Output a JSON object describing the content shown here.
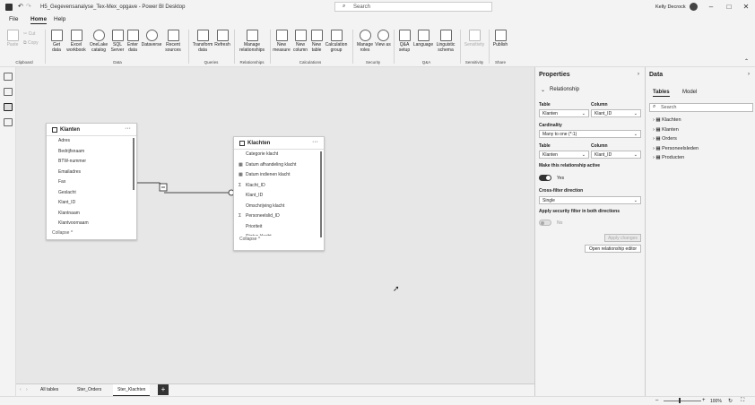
{
  "window": {
    "title": "H5_Gegevensanalyse_Tex-Mex_opgave - Power BI Desktop",
    "search_placeholder": "Search",
    "user": "Kelly Decrock"
  },
  "menu": {
    "file": "File",
    "home": "Home",
    "help": "Help"
  },
  "ribbon": {
    "clipboard": {
      "paste": "Paste",
      "cut": "Cut",
      "copy": "Copy",
      "group": "Clipboard"
    },
    "data": {
      "get_data": "Get data",
      "excel": "Excel workbook",
      "onelake": "OneLake catalog",
      "sql": "SQL Server",
      "enter": "Enter data",
      "dataverse": "Dataverse",
      "recent": "Recent sources",
      "group": "Data"
    },
    "queries": {
      "transform": "Transform data",
      "refresh": "Refresh",
      "group": "Queries"
    },
    "relationships": {
      "manage": "Manage relationships",
      "group": "Relationships"
    },
    "calculations": {
      "new_measure": "New measure",
      "new_column": "New column",
      "new_table": "New table",
      "calc_group": "Calculation group",
      "group": "Calculations"
    },
    "security": {
      "manage_roles": "Manage roles",
      "view_as": "View as",
      "group": "Security"
    },
    "qa": {
      "qa_setup": "Q&A setup",
      "language": "Language",
      "schema": "Linguistic schema",
      "group": "Q&A"
    },
    "sensitivity": {
      "label": "Sensitivity",
      "group": "Sensitivity"
    },
    "share": {
      "publish": "Publish",
      "group": "Share"
    }
  },
  "model": {
    "table1": {
      "name": "Klanten",
      "fields": [
        "Adres",
        "Bedrijfsnaam",
        "BTW-nummer",
        "Emailadres",
        "Fax",
        "Geslacht",
        "Klant_ID",
        "Klantnaam",
        "Klantvoornaam"
      ],
      "collapse": "Collapse ^"
    },
    "table2": {
      "name": "Klachten",
      "fields": [
        {
          "icon": "",
          "name": "Categorie klacht"
        },
        {
          "icon": "▦",
          "name": "Datum afhandeling klacht"
        },
        {
          "icon": "▦",
          "name": "Datum indienen klacht"
        },
        {
          "icon": "Σ",
          "name": "Klacht_ID"
        },
        {
          "icon": "",
          "name": "Klant_ID"
        },
        {
          "icon": "",
          "name": "Omschrijving klacht"
        },
        {
          "icon": "Σ",
          "name": "Personeelslid_ID"
        },
        {
          "icon": "",
          "name": "Prioriteit"
        },
        {
          "icon": "",
          "name": "Status klacht"
        }
      ],
      "collapse": "Collapse ^"
    }
  },
  "page_tabs": {
    "all": "All tables",
    "t1": "Ster_Orders",
    "t2": "Ster_Klachten",
    "add": "+"
  },
  "status": {
    "zoom": "100%"
  },
  "properties": {
    "title": "Properties",
    "section": "Relationship",
    "table_label": "Table",
    "column_label": "Column",
    "table1": "Klanten",
    "column1": "Klant_ID",
    "cardinality_label": "Cardinality",
    "cardinality": "Many to one (*:1)",
    "table2": "Klanten",
    "column2": "Klant_ID",
    "active_label": "Make this relationship active",
    "active_value": "Yes",
    "crossfilter_label": "Cross-filter direction",
    "crossfilter": "Single",
    "security_label": "Apply security filter in both directions",
    "security_value": "No",
    "apply": "Apply changes",
    "open_editor": "Open relationship editor"
  },
  "data_pane": {
    "title": "Data",
    "tab_tables": "Tables",
    "tab_model": "Model",
    "search_placeholder": "Search",
    "tables": [
      "Klachten",
      "Klanten",
      "Orders",
      "Personeelsleden",
      "Producten"
    ]
  }
}
